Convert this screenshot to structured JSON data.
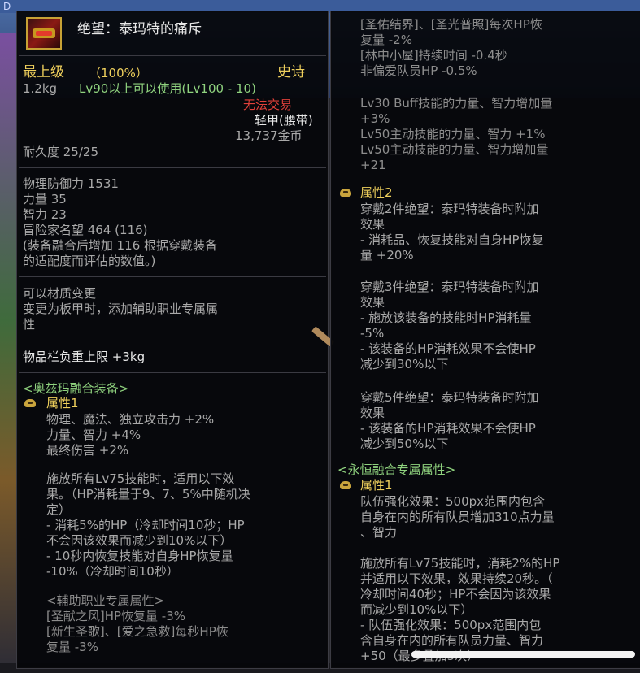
{
  "background": {
    "corner_text": "D"
  },
  "item": {
    "name": "绝望：泰玛特的痛斥",
    "grade": "最上级",
    "grade_pct": "（100%）",
    "rarity": "史诗",
    "weight": "1.2kg",
    "level_req": "Lv90以上可以使用(Lv100 - 10)",
    "trade": "无法交易",
    "type": "轻甲(腰带)",
    "price": "13,737金币",
    "durability": "耐久度 25/25",
    "stats": [
      "物理防御力 1531",
      "力量 35",
      "智力 23",
      "冒险家名望 464 (116)"
    ],
    "fusion_note_line1": "(装备融合后增加 116 根据穿戴装备",
    "fusion_note_line2": "的适配度而评估的数值。)",
    "material_change": "可以材质变更",
    "material_change_desc1": "变更为板甲时，添加辅助职业专属属",
    "material_change_desc2": "性",
    "inventory_weight": "物品栏负重上限 +3kg",
    "fusion_header": "<奥兹玛融合装备>",
    "attr1_label": "属性1",
    "attr1_lines": [
      "物理、魔法、独立攻击力 +2%",
      "力量、智力 +4%",
      "最终伤害 +2%"
    ],
    "lv75_lines": [
      "施放所有Lv75技能时，适用以下效",
      "果。（HP消耗量于9、7、5%中随机决",
      "定）",
      "- 消耗5%的HP（冷却时间10秒；HP",
      "不会因该效果而减少到10%以下）",
      "- 10秒内恢复技能对自身HP恢复量",
      "-10%（冷却时间10秒）"
    ],
    "support_header": "<辅助职业专属属性>",
    "support_lines_left": [
      "[圣献之风]HP恢复量 -3%",
      "[新生圣歌]、[爱之急救]每秒HP恢",
      "复量 -3%"
    ],
    "support_lines_right": [
      "[圣佑结界]、[圣光普照]每次HP恢",
      "复量 -2%",
      "[林中小屋]持续时间 -0.4秒",
      "非偏爱队员HP -0.5%"
    ],
    "buff_lines": [
      "Lv30 Buff技能的力量、智力增加量",
      "+3%",
      "Lv50主动技能的力量、智力 +1%",
      "Lv50主动技能的力量、智力增加量",
      "+21"
    ],
    "attr2_label": "属性2",
    "set_blocks": [
      [
        "穿戴2件绝望：泰玛特装备时附加",
        "效果",
        "- 消耗品、恢复技能对自身HP恢复",
        "量 +20%"
      ],
      [
        "穿戴3件绝望：泰玛特装备时附加",
        "效果",
        "- 施放该装备的技能时HP消耗量",
        "-5%",
        "- 该装备的HP消耗效果不会使HP",
        "减少到30%以下"
      ],
      [
        "穿戴5件绝望：泰玛特装备时附加",
        "效果",
        "- 该装备的HP消耗效果不会使HP",
        "减少到50%以下"
      ]
    ],
    "eternal_header": "<永恒融合专属属性>",
    "eternal_attr_label": "属性1",
    "eternal_lines": [
      "队伍强化效果：500px范围内包含",
      "自身在内的所有队员增加310点力量",
      "、智力",
      "",
      "施放所有Lv75技能时，消耗2%的HP",
      "并适用以下效果，效果持续20秒。（",
      "冷却时间40秒；HP不会因为该效果",
      "而减少到10%以下）",
      "- 队伍强化效果：500px范围内包",
      "含自身在内的所有队员力量、智力",
      "+50（最多叠加5次）"
    ]
  }
}
